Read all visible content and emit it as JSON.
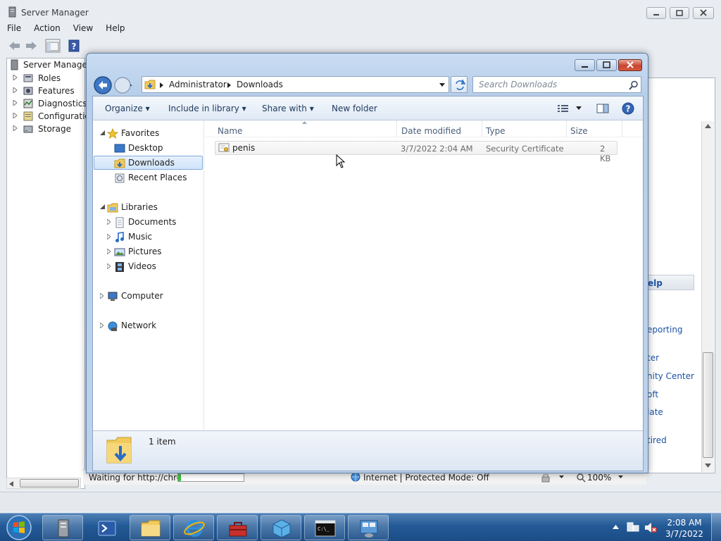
{
  "server_manager": {
    "title": "Server Manager",
    "menu": [
      "File",
      "Action",
      "View",
      "Help"
    ],
    "tree": [
      "Server Manager (",
      "Roles",
      "Features",
      "Diagnostics",
      "Configuration",
      "Storage"
    ],
    "right_pane": {
      "help_header": "elp",
      "links": [
        "eporting",
        "ter",
        "nity Center",
        "oft",
        "late",
        "tired"
      ]
    }
  },
  "ie_status": {
    "left": "Waiting for http://chro",
    "zone": "Internet | Protected Mode: Off",
    "zoom": "100%"
  },
  "explorer": {
    "address": [
      "Administrator",
      "Downloads"
    ],
    "search_placeholder": "Search Downloads",
    "commands": {
      "organize": "Organize",
      "include": "Include in library",
      "share": "Share with",
      "new_folder": "New folder"
    },
    "nav": {
      "favorites": "Favorites",
      "desktop": "Desktop",
      "downloads": "Downloads",
      "recent": "Recent Places",
      "libraries": "Libraries",
      "documents": "Documents",
      "music": "Music",
      "pictures": "Pictures",
      "videos": "Videos",
      "computer": "Computer",
      "network": "Network"
    },
    "columns": [
      "Name",
      "Date modified",
      "Type",
      "Size"
    ],
    "files": [
      {
        "name": "penis",
        "date": "3/7/2022 2:04 AM",
        "type": "Security Certificate",
        "size": "2 KB"
      }
    ],
    "item_count": "1 item"
  },
  "taskbar": {
    "time": "2:08 AM",
    "date": "3/7/2022",
    "apps": [
      "server-manager-icon",
      "powershell-icon",
      "explorer-icon",
      "internet-explorer-icon",
      "toolbox-icon",
      "package-icon",
      "cmd-icon",
      "control-panel-icon"
    ]
  }
}
